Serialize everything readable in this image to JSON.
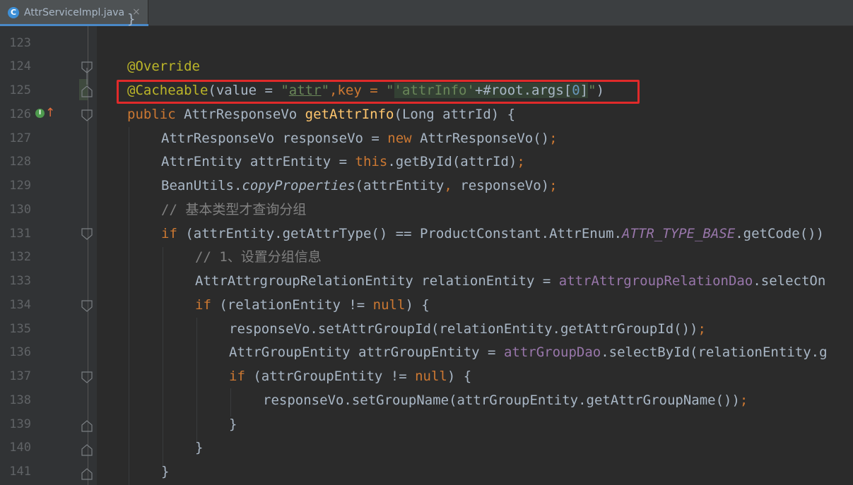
{
  "tab": {
    "icon": "java-class-icon",
    "icon_letter": "C",
    "label": "AttrServiceImpl.java",
    "close": "×"
  },
  "top_partial": "}",
  "lines": [
    {
      "n": "123"
    },
    {
      "n": "124"
    },
    {
      "n": "125"
    },
    {
      "n": "126"
    },
    {
      "n": "127"
    },
    {
      "n": "128"
    },
    {
      "n": "129"
    },
    {
      "n": "130"
    },
    {
      "n": "131"
    },
    {
      "n": "132"
    },
    {
      "n": "133"
    },
    {
      "n": "134"
    },
    {
      "n": "135"
    },
    {
      "n": "136"
    },
    {
      "n": "137"
    },
    {
      "n": "138"
    },
    {
      "n": "139"
    },
    {
      "n": "140"
    },
    {
      "n": "141"
    }
  ],
  "code": {
    "l124": "@Override",
    "l125": [
      "@Cacheable",
      "(value = ",
      "\"",
      "attr",
      "\"",
      ",key = ",
      "\"",
      "'attrInfo'",
      "+#root.args[",
      "0",
      "]",
      "\"",
      ")"
    ],
    "l126": [
      "public ",
      "AttrResponseVo ",
      "getAttrInfo",
      "(Long attrId) {"
    ],
    "l127": [
      "AttrResponseVo responseVo = ",
      "new ",
      "AttrResponseVo()",
      ";"
    ],
    "l128": [
      "AttrEntity attrEntity = ",
      "this",
      ".getById(attrId)",
      ";"
    ],
    "l129": [
      "BeanUtils.",
      "copyProperties",
      "(attrEntity",
      ", ",
      "responseVo)",
      ";"
    ],
    "l130": "// 基本类型才查询分组",
    "l131": [
      "if ",
      "(attrEntity.getAttrType() == ProductConstant.AttrEnum.",
      "ATTR_TYPE_BASE",
      ".getCode())"
    ],
    "l132": "// 1、设置分组信息",
    "l133": [
      "AttrAttrgroupRelationEntity relationEntity = ",
      "attrAttrgroupRelationDao",
      ".selectOn"
    ],
    "l134": [
      "if ",
      "(relationEntity != ",
      "null",
      ") {"
    ],
    "l135": [
      "responseVo.setAttrGroupId(relationEntity.getAttrGroupId())",
      ";"
    ],
    "l136": [
      "AttrGroupEntity attrGroupEntity = ",
      "attrGroupDao",
      ".selectById(relationEntity.g"
    ],
    "l137": [
      "if ",
      "(attrGroupEntity != ",
      "null",
      ") {"
    ],
    "l138": [
      "responseVo.setGroupName(attrGroupEntity.getAttrGroupName())",
      ";"
    ],
    "l139": "}",
    "l140": "}",
    "l141": "}"
  },
  "gutter_icons": {
    "implements": "I",
    "implements_icon": "implements-marker-icon",
    "override_up": "↑",
    "override_icon": "override-arrow-icon"
  },
  "colors": {
    "background": "#2b2b2b",
    "keyword": "#cc7832",
    "annotation": "#bbb529",
    "string": "#6a8759",
    "method": "#ffc66d",
    "field": "#9876aa",
    "comment": "#808080",
    "number": "#6897bb",
    "highlight": "#e02a2a"
  }
}
